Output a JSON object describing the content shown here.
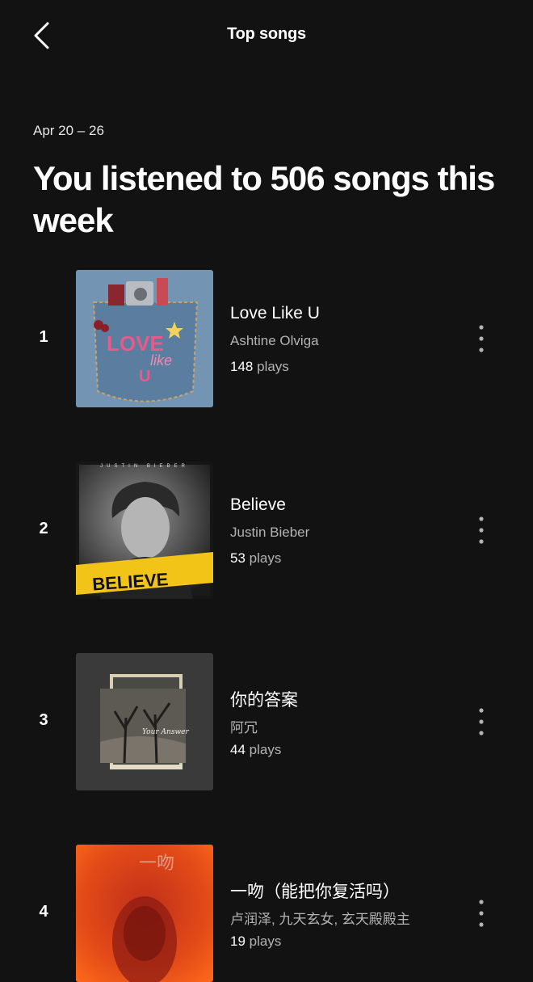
{
  "header": {
    "title": "Top songs",
    "back_icon": "chevron-left-icon"
  },
  "summary": {
    "date_range": "Apr 20 – 26",
    "headline": "You listened to 506 songs this week"
  },
  "plays_suffix": "plays",
  "songs": [
    {
      "rank": "1",
      "title": "Love Like U",
      "artist": "Ashtine Olviga",
      "plays": "148",
      "cover": "denim pocket artwork with 'LOVE like U' text"
    },
    {
      "rank": "2",
      "title": "Believe",
      "artist": "Justin Bieber",
      "plays": "53",
      "cover": "black-and-white portrait with yellow 'BELIEVE' banner"
    },
    {
      "rank": "3",
      "title": "你的答案",
      "artist": "阿冗",
      "plays": "44",
      "cover": "dark photo of bare trees"
    },
    {
      "rank": "4",
      "title": "一吻（能把你复活吗）",
      "artist": "卢润泽, 九天玄女, 玄天殿殿主",
      "plays": "19",
      "cover": "orange-red blurred portrait"
    }
  ],
  "colors": {
    "background": "#121212",
    "text_primary": "#ffffff",
    "text_secondary": "#b3b3b3"
  },
  "icons": {
    "more": "more-vertical-icon"
  }
}
